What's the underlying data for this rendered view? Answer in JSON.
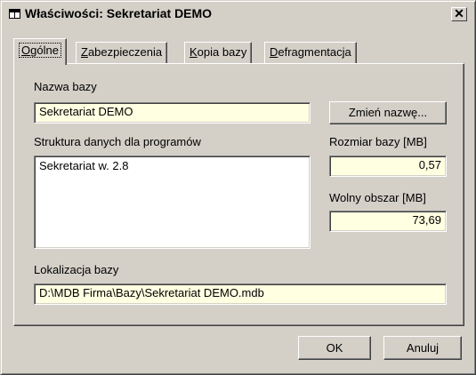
{
  "window": {
    "title": "Właściwości: Sekretariat DEMO",
    "icon": "table-icon",
    "close_glyph": "✕"
  },
  "tabs": [
    {
      "mnemonic": "O",
      "rest": "gólne",
      "active": true
    },
    {
      "mnemonic": "Z",
      "rest": "abezpieczenia",
      "active": false
    },
    {
      "mnemonic": "K",
      "rest": "opia bazy",
      "active": false
    },
    {
      "mnemonic": "D",
      "rest": "efragmentacja",
      "active": false
    }
  ],
  "general": {
    "db_name_label": "Nazwa bazy",
    "db_name_value": "Sekretariat DEMO",
    "rename_button": "Zmień nazwę...",
    "structure_label": "Struktura danych dla programów",
    "structure_items": [
      "Sekretariat w. 2.8"
    ],
    "size_label": "Rozmiar bazy [MB]",
    "size_value": "0,57",
    "free_label": "Wolny obszar [MB]",
    "free_value": "73,69",
    "location_label": "Lokalizacja bazy",
    "location_value": "D:\\MDB Firma\\Bazy\\Sekretariat DEMO.mdb"
  },
  "buttons": {
    "ok": "OK",
    "cancel": "Anuluj"
  },
  "colors": {
    "dialog_bg": "#d4d0c8",
    "readonly_field_bg": "#ffffe1"
  }
}
